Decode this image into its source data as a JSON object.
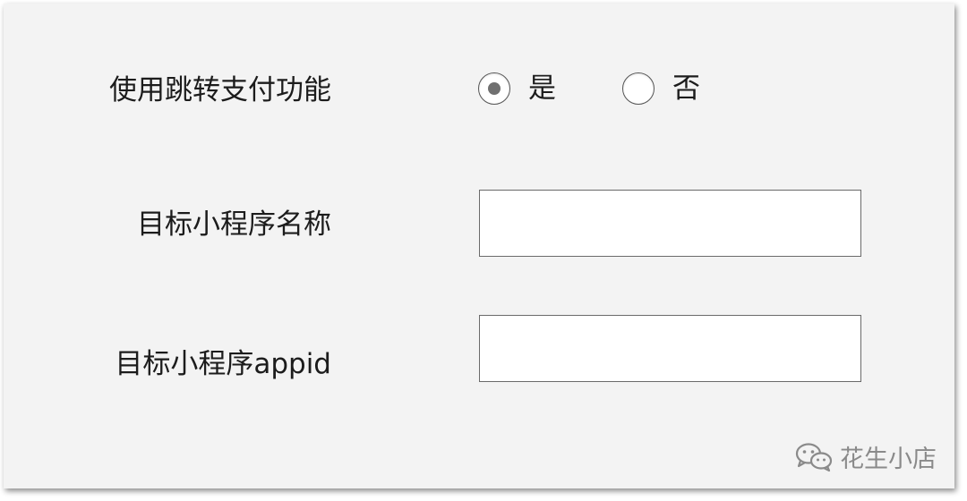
{
  "form": {
    "jump_pay": {
      "label": "使用跳转支付功能",
      "options": [
        {
          "label": "是",
          "selected": true
        },
        {
          "label": "否",
          "selected": false
        }
      ]
    },
    "target_name": {
      "label": "目标小程序名称",
      "value": ""
    },
    "target_appid": {
      "label": "目标小程序appid",
      "value": ""
    }
  },
  "watermark": {
    "text": "花生小店",
    "icon": "wechat-icon"
  },
  "colors": {
    "panel_bg": "#f3f3f3",
    "radio_dot": "#707070",
    "watermark": "#8a8a8a"
  }
}
